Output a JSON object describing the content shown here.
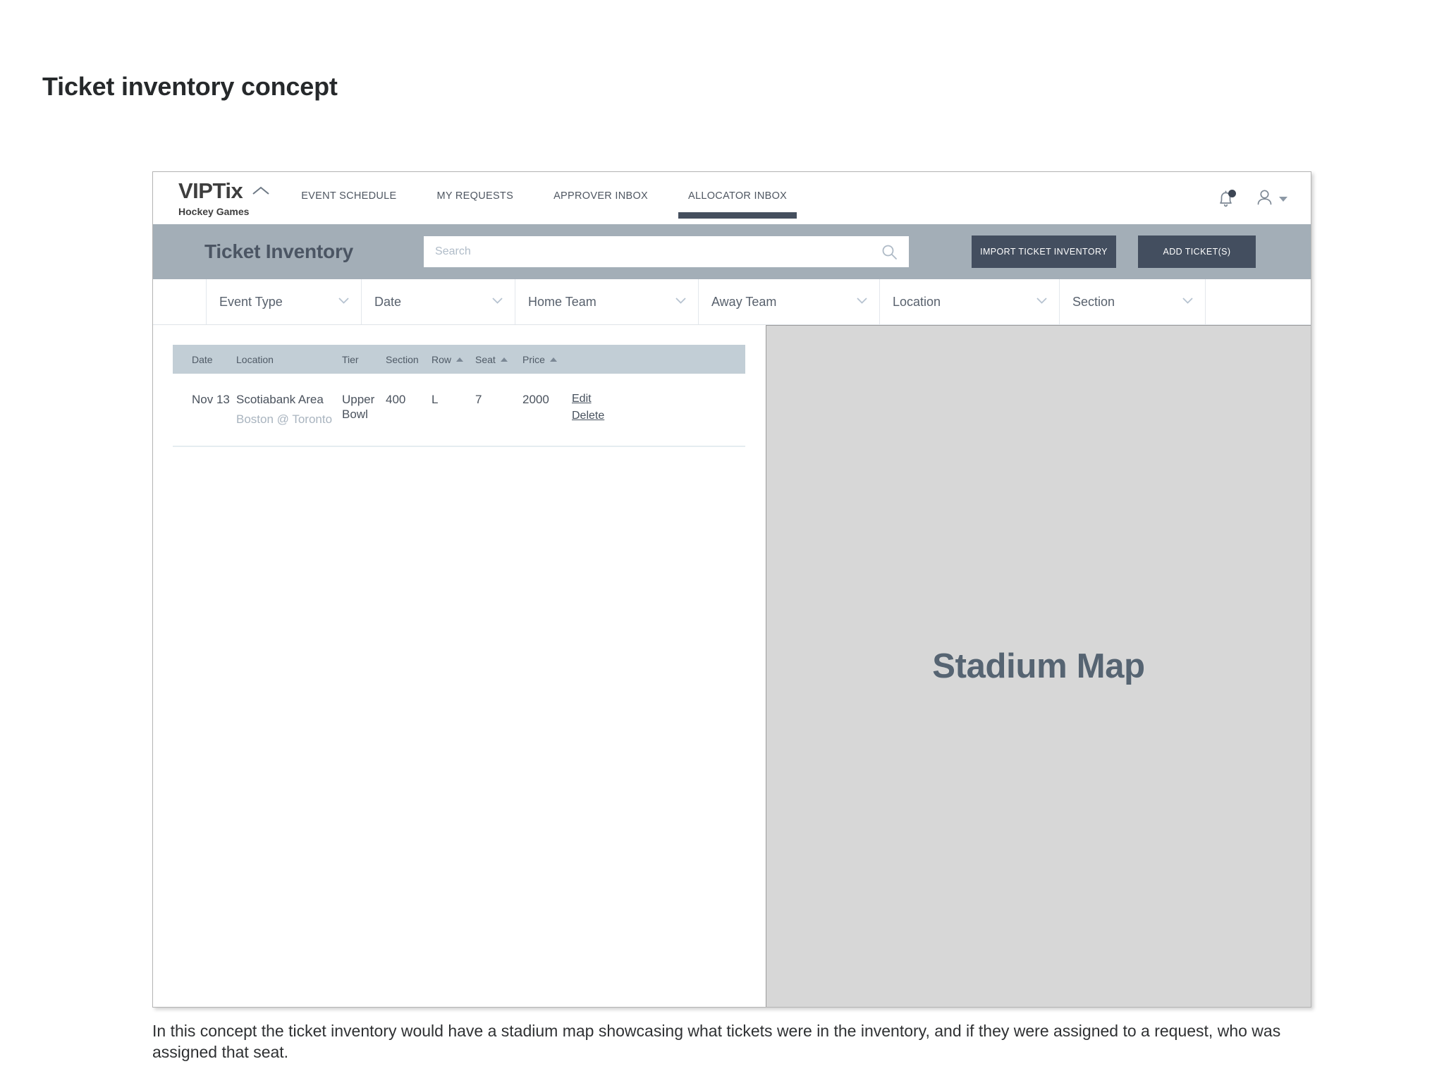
{
  "page": {
    "title": "Ticket inventory concept",
    "caption": "In this concept the ticket inventory would have a stadium map showcasing what tickets were in the inventory, and if they were assigned to a request, who was assigned that seat."
  },
  "navbar": {
    "brand_name": "VIPTix",
    "brand_sub": "Hockey Games",
    "brand_chevron_icon": "chevron-up-icon",
    "links": [
      {
        "label": "EVENT SCHEDULE",
        "active": false
      },
      {
        "label": "MY REQUESTS",
        "active": false
      },
      {
        "label": "APPROVER INBOX",
        "active": false
      },
      {
        "label": "ALLOCATOR INBOX",
        "active": true
      }
    ],
    "notification_icon": "bell-icon",
    "has_notification_badge": true,
    "user_icon": "user-icon",
    "user_caret_icon": "caret-down-icon"
  },
  "toolbar": {
    "title": "Ticket Inventory",
    "search_placeholder": "Search",
    "search_value": "",
    "search_icon": "search-icon",
    "import_label": "IMPORT TICKET INVENTORY",
    "add_label": "ADD TICKET(S)",
    "background": "#a3aeb7",
    "button_color": "#434e5f"
  },
  "filters": [
    {
      "label": "Event Type",
      "icon": "chevron-down-icon"
    },
    {
      "label": "Date",
      "icon": "chevron-down-icon"
    },
    {
      "label": "Home Team",
      "icon": "chevron-down-icon"
    },
    {
      "label": "Away Team",
      "icon": "chevron-down-icon"
    },
    {
      "label": "Location",
      "icon": "chevron-down-icon"
    },
    {
      "label": "Section",
      "icon": "chevron-down-icon"
    }
  ],
  "table": {
    "columns": [
      {
        "label": "Date",
        "sortable": false
      },
      {
        "label": "Location",
        "sortable": false
      },
      {
        "label": "Tier",
        "sortable": false
      },
      {
        "label": "Section",
        "sortable": false
      },
      {
        "label": "Row",
        "sortable": true,
        "sort": "asc"
      },
      {
        "label": "Seat",
        "sortable": true,
        "sort": "asc"
      },
      {
        "label": "Price",
        "sortable": true,
        "sort": "asc"
      }
    ],
    "rows": [
      {
        "date": "Nov 13",
        "location": "Scotiabank Area",
        "matchup": "Boston @ Toronto",
        "tier": "Upper Bowl",
        "section": "400",
        "row": "L",
        "seat": "7",
        "price": "2000",
        "edit_label": "Edit",
        "delete_label": "Delete"
      }
    ]
  },
  "stadium_map": {
    "label": "Stadium Map",
    "background": "#d7d7d7",
    "text_color": "#566472"
  }
}
